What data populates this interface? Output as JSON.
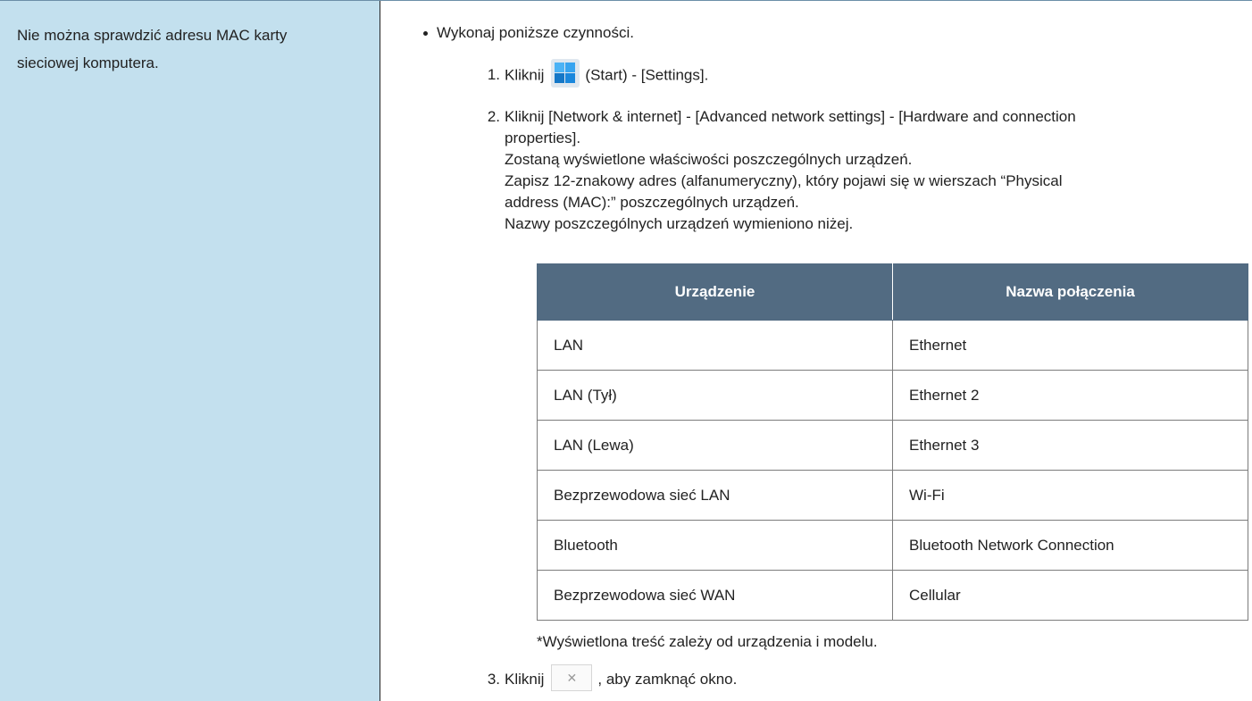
{
  "problem": {
    "text_line1": "Nie można sprawdzić adresu MAC karty",
    "text_line2": "sieciowej komputera."
  },
  "solution": {
    "bullet": "Wykonaj poniższe czynności.",
    "step1": {
      "number": "1.",
      "prefix": "Kliknij",
      "icon": "windows-start-icon",
      "suffix": "(Start) - [Settings]."
    },
    "step2": {
      "number": "2.",
      "line1": "Kliknij [Network & internet] - [Advanced network settings] - [Hardware and connection",
      "line2": "properties].",
      "line3": "Zostaną wyświetlone właściwości poszczególnych urządzeń.",
      "line4": "Zapisz 12-znakowy adres (alfanumeryczny), który pojawi się w wierszach “Physical",
      "line5": "address (MAC):” poszczególnych urządzeń.",
      "line6": "Nazwy poszczególnych urządzeń wymieniono niżej."
    },
    "table": {
      "headers": [
        "Urządzenie",
        "Nazwa połączenia"
      ],
      "rows": [
        [
          "LAN",
          "Ethernet"
        ],
        [
          "LAN (Tył)",
          "Ethernet 2"
        ],
        [
          "LAN (Lewa)",
          "Ethernet 3"
        ],
        [
          "Bezprzewodowa sieć LAN",
          "Wi-Fi"
        ],
        [
          "Bluetooth",
          "Bluetooth Network Connection"
        ],
        [
          "Bezprzewodowa sieć WAN",
          "Cellular"
        ]
      ]
    },
    "note": "*Wyświetlona treść zależy od urządzenia i modelu.",
    "step3": {
      "number": "3.",
      "prefix": "Kliknij",
      "icon": "close-icon",
      "suffix": ", aby zamknąć okno."
    }
  },
  "colors": {
    "left_cell_bg": "#c3e0ee",
    "table_header_bg": "#526b82"
  }
}
